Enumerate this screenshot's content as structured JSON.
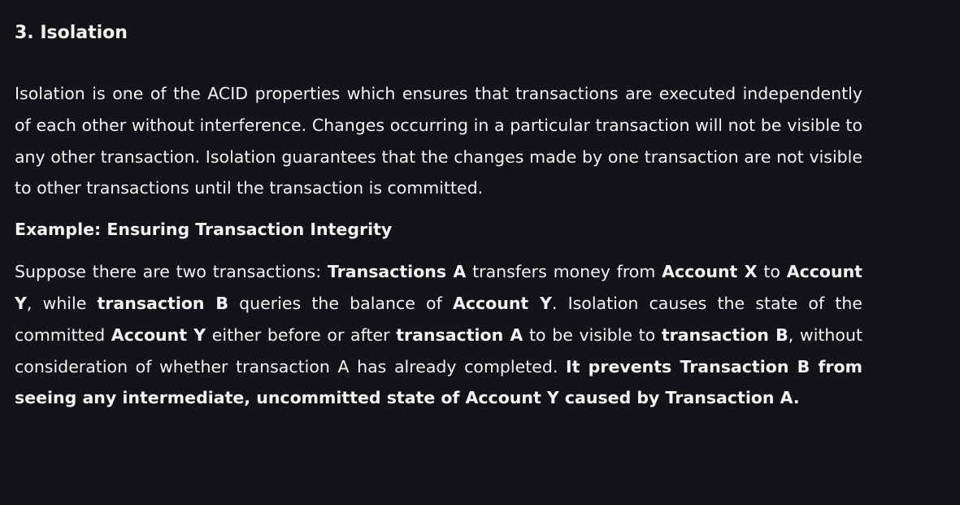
{
  "section": {
    "heading": "3. Isolation",
    "paragraph_1": "Isolation is one of the ACID properties which ensures that transactions are executed independently of each other without interference. Changes occurring in a particular transaction will not be visible to any other transaction. Isolation guarantees that the changes made by one transaction are not visible to other transactions until the transaction is committed.",
    "example_heading": "Example: Ensuring Transaction Integrity",
    "paragraph_2": {
      "s1": "Suppose there are two transactions: ",
      "s2": "Transactions A",
      "s3": " transfers money from ",
      "s4": "Account X",
      "s5": " to ",
      "s6": "Account Y",
      "s7": ", while ",
      "s8": "transaction B",
      "s9": " queries the balance of ",
      "s10": "Account Y",
      "s11": ". Isolation causes the state of the committed ",
      "s12": "Account Y",
      "s13": " either before or after ",
      "s14": "transaction A",
      "s15": " to be visible to ",
      "s16": "transaction B",
      "s17": ", without consideration of whether transaction A has already completed. ",
      "s18": "It prevents Transaction B from seeing any intermediate, uncommitted state of Account Y caused by Transaction A."
    }
  }
}
